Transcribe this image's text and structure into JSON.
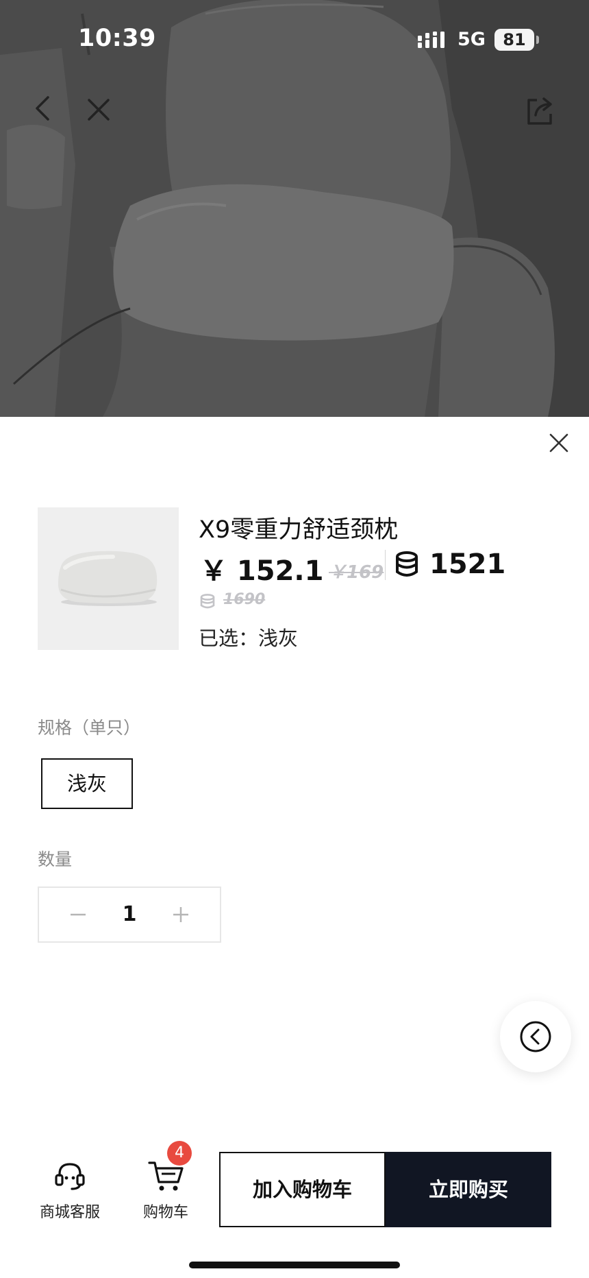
{
  "status_bar": {
    "time": "10:39",
    "network": "5G",
    "battery": "81"
  },
  "hero": {
    "icons": [
      "back-icon",
      "close-icon",
      "share-icon"
    ]
  },
  "product": {
    "title": "X9零重力舒适颈枕",
    "price_current": "￥ 152.1",
    "price_original": "￥169",
    "points_current": "1521",
    "points_original": "1690",
    "selected_label": "已选：",
    "selected_value": "浅灰"
  },
  "spec": {
    "label": "规格（单只）",
    "options": [
      "浅灰"
    ]
  },
  "quantity": {
    "label": "数量",
    "value": "1"
  },
  "bottom_bar": {
    "service_label": "商城客服",
    "cart_label": "购物车",
    "cart_badge": "4",
    "add_to_cart": "加入购物车",
    "buy_now": "立即购买"
  },
  "colors": {
    "overlay": "#4a4a4a",
    "buy_button": "#111623",
    "badge": "#e84a3f",
    "strikethrough": "#c3c3c7"
  }
}
